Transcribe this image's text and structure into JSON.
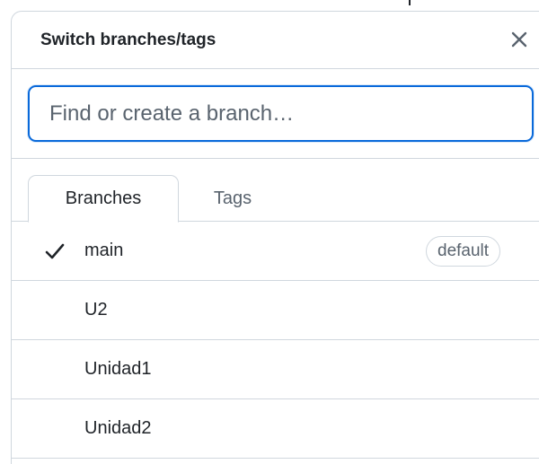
{
  "dialog": {
    "title": "Switch branches/tags",
    "close_icon": "close-icon"
  },
  "search": {
    "placeholder": "Find or create a branch…",
    "value": ""
  },
  "tabs": [
    {
      "label": "Branches",
      "active": true
    },
    {
      "label": "Tags",
      "active": false
    }
  ],
  "branches": [
    {
      "name": "main",
      "selected": true,
      "badge": "default"
    },
    {
      "name": "U2",
      "selected": false,
      "badge": ""
    },
    {
      "name": "Unidad1",
      "selected": false,
      "badge": ""
    },
    {
      "name": "Unidad2",
      "selected": false,
      "badge": ""
    }
  ],
  "colors": {
    "accent": "#0969da",
    "border": "#d0d7de",
    "muted_text": "#59636e",
    "text": "#1f2328"
  }
}
